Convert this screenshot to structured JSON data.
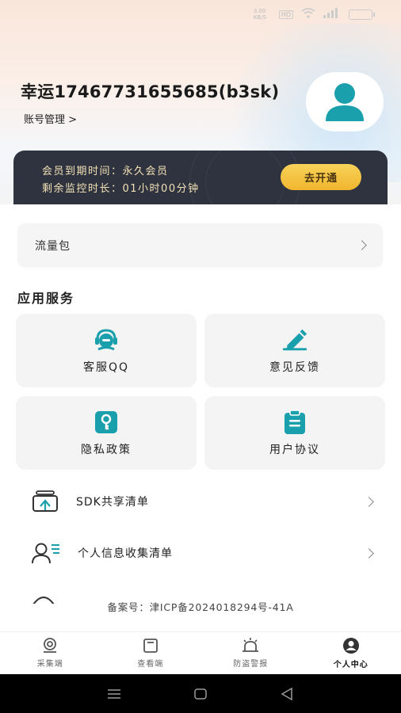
{
  "status_bar": {
    "speed": "3.00 KB/S",
    "network_badge": "HD",
    "signal_label": "5G"
  },
  "profile": {
    "username": "幸运17467731655685(b3sk)",
    "account_manage": "账号管理 >"
  },
  "vip": {
    "expiry": "会员到期时间：永久会员",
    "remaining": "剩余监控时长：01小时00分钟",
    "open_button": "去开通",
    "card_color": "#2e333f",
    "button_color": "#f3c242"
  },
  "traffic_package": {
    "label": "流量包"
  },
  "services": {
    "title": "应用服务",
    "tiles": [
      {
        "label": "客服QQ",
        "icon": "customer-service-icon"
      },
      {
        "label": "意见反馈",
        "icon": "feedback-pen-icon"
      },
      {
        "label": "隐私政策",
        "icon": "privacy-key-icon"
      },
      {
        "label": "用户协议",
        "icon": "agreement-clipboard-icon"
      }
    ],
    "accent_color": "#1a9fad"
  },
  "list": [
    {
      "label": "SDK共享清单",
      "icon": "sdk-share-icon"
    },
    {
      "label": "个人信息收集清单",
      "icon": "personal-info-icon"
    }
  ],
  "icp": "备案号：津ICP备2024018294号-41A",
  "tabs": [
    {
      "label": "采集端",
      "icon": "camera-icon"
    },
    {
      "label": "查看端",
      "icon": "viewer-icon"
    },
    {
      "label": "防盗警报",
      "icon": "alarm-icon"
    },
    {
      "label": "个人中心",
      "icon": "profile-icon",
      "active": true
    }
  ]
}
